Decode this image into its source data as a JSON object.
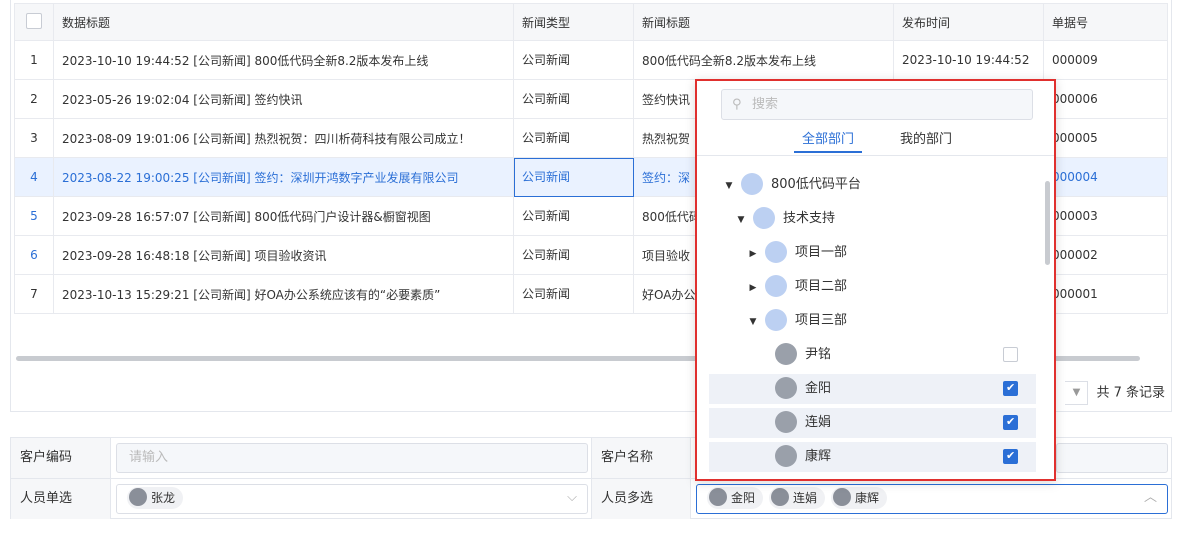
{
  "table": {
    "headers": [
      "数据标题",
      "新闻类型",
      "新闻标题",
      "发布时间",
      "单据号"
    ],
    "rows": [
      {
        "idx": "1",
        "title": "2023-10-10 19:44:52 [公司新闻] 800低代码全新8.2版本发布上线",
        "type": "公司新闻",
        "news": "800低代码全新8.2版本发布上线",
        "time": "2023-10-10 19:44:52",
        "no": "000009"
      },
      {
        "idx": "2",
        "title": "2023-05-26 19:02:04 [公司新闻] 签约快讯",
        "type": "公司新闻",
        "news": "签约快讯",
        "time": "",
        "no": "000006"
      },
      {
        "idx": "3",
        "title": "2023-08-09 19:01:06 [公司新闻] 热烈祝贺：四川析荷科技有限公司成立！",
        "type": "公司新闻",
        "news": "热烈祝贺",
        "time": "",
        "no": "000005"
      },
      {
        "idx": "4",
        "title": "2023-08-22 19:00:25 [公司新闻] 签约：深圳开鸿数字产业发展有限公司",
        "type": "公司新闻",
        "news": "签约：深",
        "time": "",
        "no": "000004"
      },
      {
        "idx": "5",
        "title": "2023-09-28 16:57:07 [公司新闻] 800低代码门户设计器&橱窗视图",
        "type": "公司新闻",
        "news": "800低代码",
        "time": "",
        "no": "000003"
      },
      {
        "idx": "6",
        "title": "2023-09-28 16:48:18 [公司新闻] 项目验收资讯",
        "type": "公司新闻",
        "news": "项目验收",
        "time": "",
        "no": "000002"
      },
      {
        "idx": "7",
        "title": "2023-10-13 15:29:21 [公司新闻] 好OA办公系统应该有的“必要素质”",
        "type": "公司新闻",
        "news": "好OA办公",
        "time": "",
        "no": "000001"
      }
    ],
    "selected_row": 3,
    "total": "共 7 条记录"
  },
  "form": {
    "customer_code_label": "客户编码",
    "customer_code_placeholder": "请输入",
    "customer_name_label": "客户名称",
    "single_label": "人员单选",
    "single_value": "张龙",
    "multi_label": "人员多选",
    "multi_values": [
      "金阳",
      "连娟",
      "康辉"
    ]
  },
  "popup": {
    "search_placeholder": "搜索",
    "tab_all": "全部部门",
    "tab_mine": "我的部门",
    "tree": [
      {
        "label": "800低代码平台",
        "kind": "org",
        "level": 0,
        "caret": "down"
      },
      {
        "label": "技术支持",
        "kind": "org",
        "level": 1,
        "caret": "down"
      },
      {
        "label": "项目一部",
        "kind": "org",
        "level": 2,
        "caret": "right"
      },
      {
        "label": "项目二部",
        "kind": "org",
        "level": 2,
        "caret": "right"
      },
      {
        "label": "项目三部",
        "kind": "org",
        "level": 2,
        "caret": "down"
      },
      {
        "label": "尹铭",
        "kind": "person",
        "level": 3,
        "checked": false
      },
      {
        "label": "金阳",
        "kind": "person",
        "level": 3,
        "checked": true
      },
      {
        "label": "连娟",
        "kind": "person",
        "level": 3,
        "checked": true
      },
      {
        "label": "康辉",
        "kind": "person",
        "level": 3,
        "checked": true
      }
    ]
  },
  "colors": {
    "accent": "#2b6fd6",
    "highlight_border": "#e0302e"
  }
}
